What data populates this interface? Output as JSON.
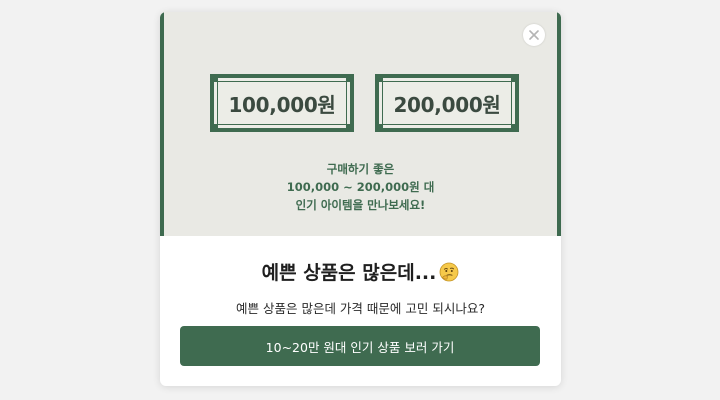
{
  "popup": {
    "banner": {
      "vouchers": [
        {
          "amount": "100,000원"
        },
        {
          "amount": "200,000원"
        }
      ],
      "lines": [
        "구매하기 좋은",
        "100,000 ~ 200,000원 대",
        "인기 아이템을 만나보세요!"
      ],
      "accent_color": "#3f6b50",
      "background_color": "#e9e9e4"
    },
    "close_icon": "close-icon",
    "headline": "예쁜 상품은 많은데...",
    "headline_emoji": "thinking-face-icon",
    "subtext": "예쁜 상품은 많은데 가격 때문에 고민 되시나요?",
    "cta_label": "10~20만 원대 인기 상품 보러 가기",
    "cta_color": "#3f6b50"
  }
}
